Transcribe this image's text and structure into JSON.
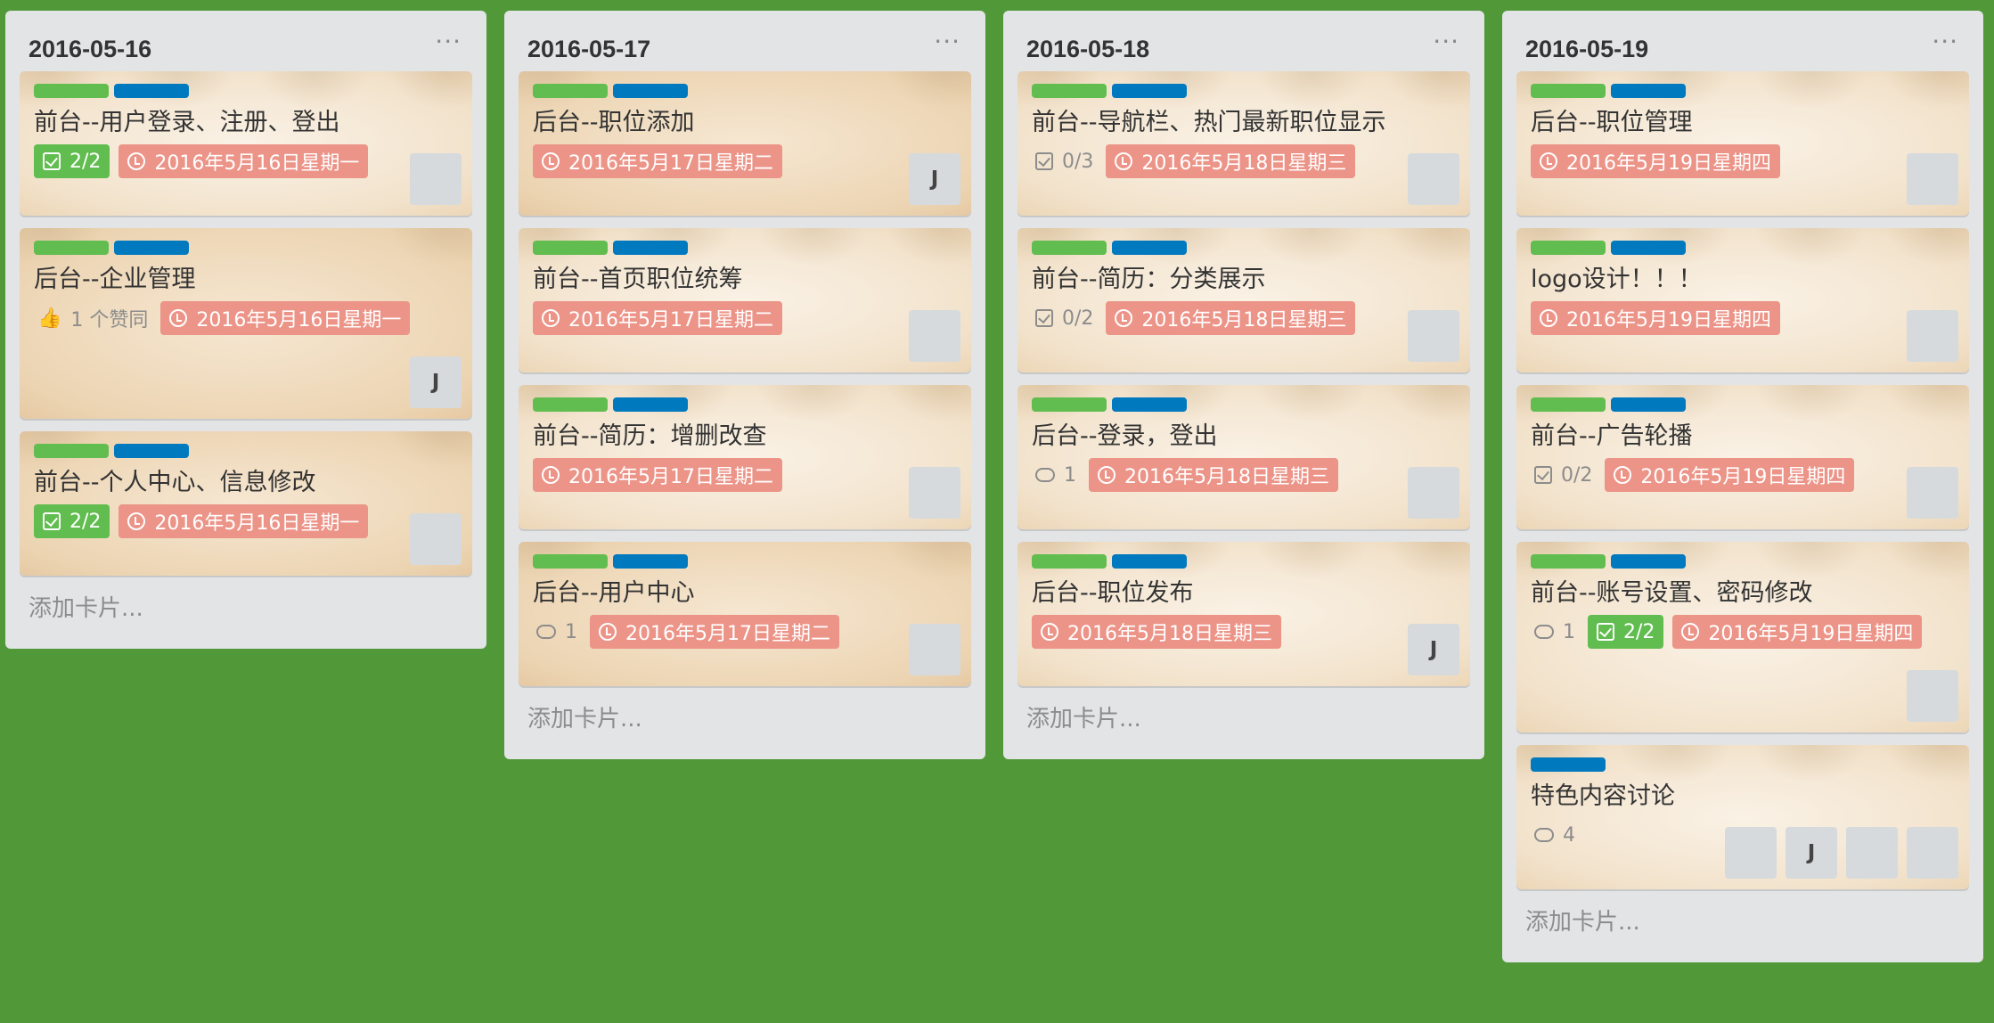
{
  "lists": [
    {
      "title": "2016-05-16",
      "menu": "···",
      "add_card": "添加卡片...",
      "cards": [
        {
          "title": "前台--用户登录、注册、登出",
          "checklist": "2/2",
          "due": "2016年5月16日星期一",
          "member": ""
        },
        {
          "title": "后台--企业管理",
          "votes": "1 个赞同",
          "due": "2016年5月16日星期一",
          "member": "J"
        },
        {
          "title": "前台--个人中心、信息修改",
          "checklist": "2/2",
          "due": "2016年5月16日星期一",
          "member": ""
        }
      ]
    },
    {
      "title": "2016-05-17",
      "menu": "···",
      "add_card": "添加卡片...",
      "cards": [
        {
          "title": "后台--职位添加",
          "due": "2016年5月17日星期二",
          "member": "J"
        },
        {
          "title": "前台--首页职位统筹",
          "due": "2016年5月17日星期二",
          "member": ""
        },
        {
          "title": "前台--简历：增删改查",
          "due": "2016年5月17日星期二",
          "member": ""
        },
        {
          "title": "后台--用户中心",
          "comments": "1",
          "due": "2016年5月17日星期二",
          "member": ""
        }
      ]
    },
    {
      "title": "2016-05-18",
      "menu": "···",
      "add_card": "添加卡片...",
      "cards": [
        {
          "title": "前台--导航栏、热门最新职位显示",
          "checklist": "0/3",
          "due": "2016年5月18日星期三",
          "member": ""
        },
        {
          "title": "前台--简历：分类展示",
          "checklist": "0/2",
          "due": "2016年5月18日星期三",
          "member": ""
        },
        {
          "title": "后台--登录，登出",
          "comments": "1",
          "due": "2016年5月18日星期三",
          "member": ""
        },
        {
          "title": "后台--职位发布",
          "due": "2016年5月18日星期三",
          "member": "J"
        }
      ]
    },
    {
      "title": "2016-05-19",
      "menu": "···",
      "add_card": "添加卡片...",
      "cards": [
        {
          "title": "后台--职位管理",
          "due": "2016年5月19日星期四",
          "member": ""
        },
        {
          "title": "logo设计！！！",
          "due": "2016年5月19日星期四",
          "member": ""
        },
        {
          "title": "前台--广告轮播",
          "checklist": "0/2",
          "due": "2016年5月19日星期四",
          "member": ""
        },
        {
          "title": "前台--账号设置、密码修改",
          "comments": "1",
          "checklist": "2/2",
          "due": "2016年5月19日星期四",
          "member": ""
        },
        {
          "title": "特色内容讨论",
          "comments": "4",
          "members": [
            "",
            "J",
            "",
            ""
          ]
        }
      ]
    }
  ],
  "colors": {
    "board_bg": "#519839",
    "label_green": "#61bd4f",
    "label_blue": "#0079bf",
    "due_badge": "#ec9488",
    "checklist_done": "#61bd4f"
  }
}
